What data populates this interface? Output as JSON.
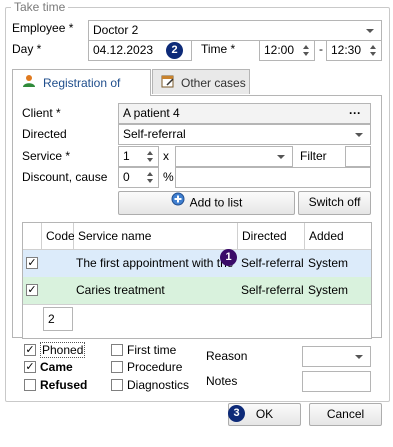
{
  "group_title": "Take time",
  "employee": {
    "label": "Employee *",
    "value": "Doctor 2"
  },
  "day": {
    "label": "Day *",
    "value": "04.12.2023"
  },
  "time": {
    "label": "Time *",
    "from": "12:00",
    "sep": "-",
    "to": "12:30"
  },
  "tabs": [
    {
      "label": "Registration of client",
      "active": true
    },
    {
      "label": "Other cases",
      "active": false
    }
  ],
  "client": {
    "label": "Client *",
    "value": "A patient 4",
    "ellipsis": "···"
  },
  "directed": {
    "label": "Directed",
    "value": "Self-referral"
  },
  "service": {
    "label": "Service *",
    "qty": "1",
    "times": "x",
    "value": "",
    "filter_label": "Filter"
  },
  "discount": {
    "label": "Discount, cause",
    "value": "0",
    "percent": "%",
    "cause": ""
  },
  "buttons": {
    "add_to_list": "Add to list",
    "switch_off": "Switch off",
    "ok": "OK",
    "cancel": "Cancel"
  },
  "table": {
    "headers": [
      "Code",
      "Service name",
      "Directed",
      "Added"
    ],
    "rows": [
      {
        "checked": true,
        "code": "",
        "service": "The first appointment with the",
        "directed": "Self-referral",
        "added": "System"
      },
      {
        "checked": true,
        "code": "",
        "service": "Caries treatment",
        "directed": "Self-referral",
        "added": "System"
      }
    ],
    "footer_count": "2"
  },
  "status_checks": {
    "phoned": {
      "label": "Phoned",
      "checked": true
    },
    "came": {
      "label": "Came",
      "checked": true
    },
    "refused": {
      "label": "Refused",
      "checked": false
    },
    "first_time": {
      "label": "First time",
      "checked": false
    },
    "procedure": {
      "label": "Procedure",
      "checked": false
    },
    "diagnostics": {
      "label": "Diagnostics",
      "checked": false
    }
  },
  "reason": {
    "label": "Reason",
    "value": ""
  },
  "notes": {
    "label": "Notes",
    "value": ""
  },
  "callouts": {
    "one": "1",
    "two": "2",
    "three": "3"
  },
  "colors": {
    "row1_bg": "#dcebfa",
    "row2_bg": "#d9f2dd",
    "badge_navy": "#0d2a78",
    "badge_purple": "#3a0b69"
  }
}
